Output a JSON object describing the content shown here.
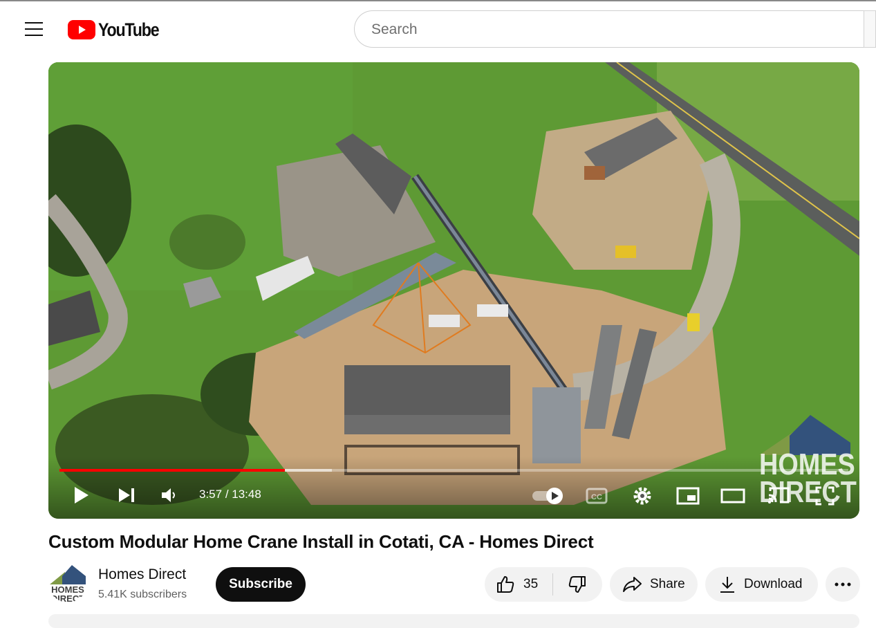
{
  "header": {
    "logo_text": "YouTube",
    "search_placeholder": "Search"
  },
  "player": {
    "current_time": "3:57",
    "duration": "13:48",
    "time_separator": " / ",
    "progress_fraction": 0.286,
    "buffered_fraction": 0.345,
    "watermark_text": "HOMES DIRECT",
    "accent_color": "#ff0000"
  },
  "video": {
    "title": "Custom Modular Home Crane Install in Cotati, CA - Homes Direct"
  },
  "channel": {
    "name": "Homes Direct",
    "subscribers": "5.41K subscribers",
    "avatar_text": "HOMES DIRECT"
  },
  "actions": {
    "subscribe_label": "Subscribe",
    "like_count": "35",
    "share_label": "Share",
    "download_label": "Download"
  },
  "icons": [
    "menu-icon",
    "youtube-logo-icon",
    "play-icon",
    "next-icon",
    "volume-icon",
    "autoplay-toggle-icon",
    "captions-icon",
    "settings-icon",
    "miniplayer-icon",
    "theater-icon",
    "cast-icon",
    "fullscreen-icon",
    "like-icon",
    "dislike-icon",
    "share-icon",
    "download-icon",
    "more-icon"
  ]
}
